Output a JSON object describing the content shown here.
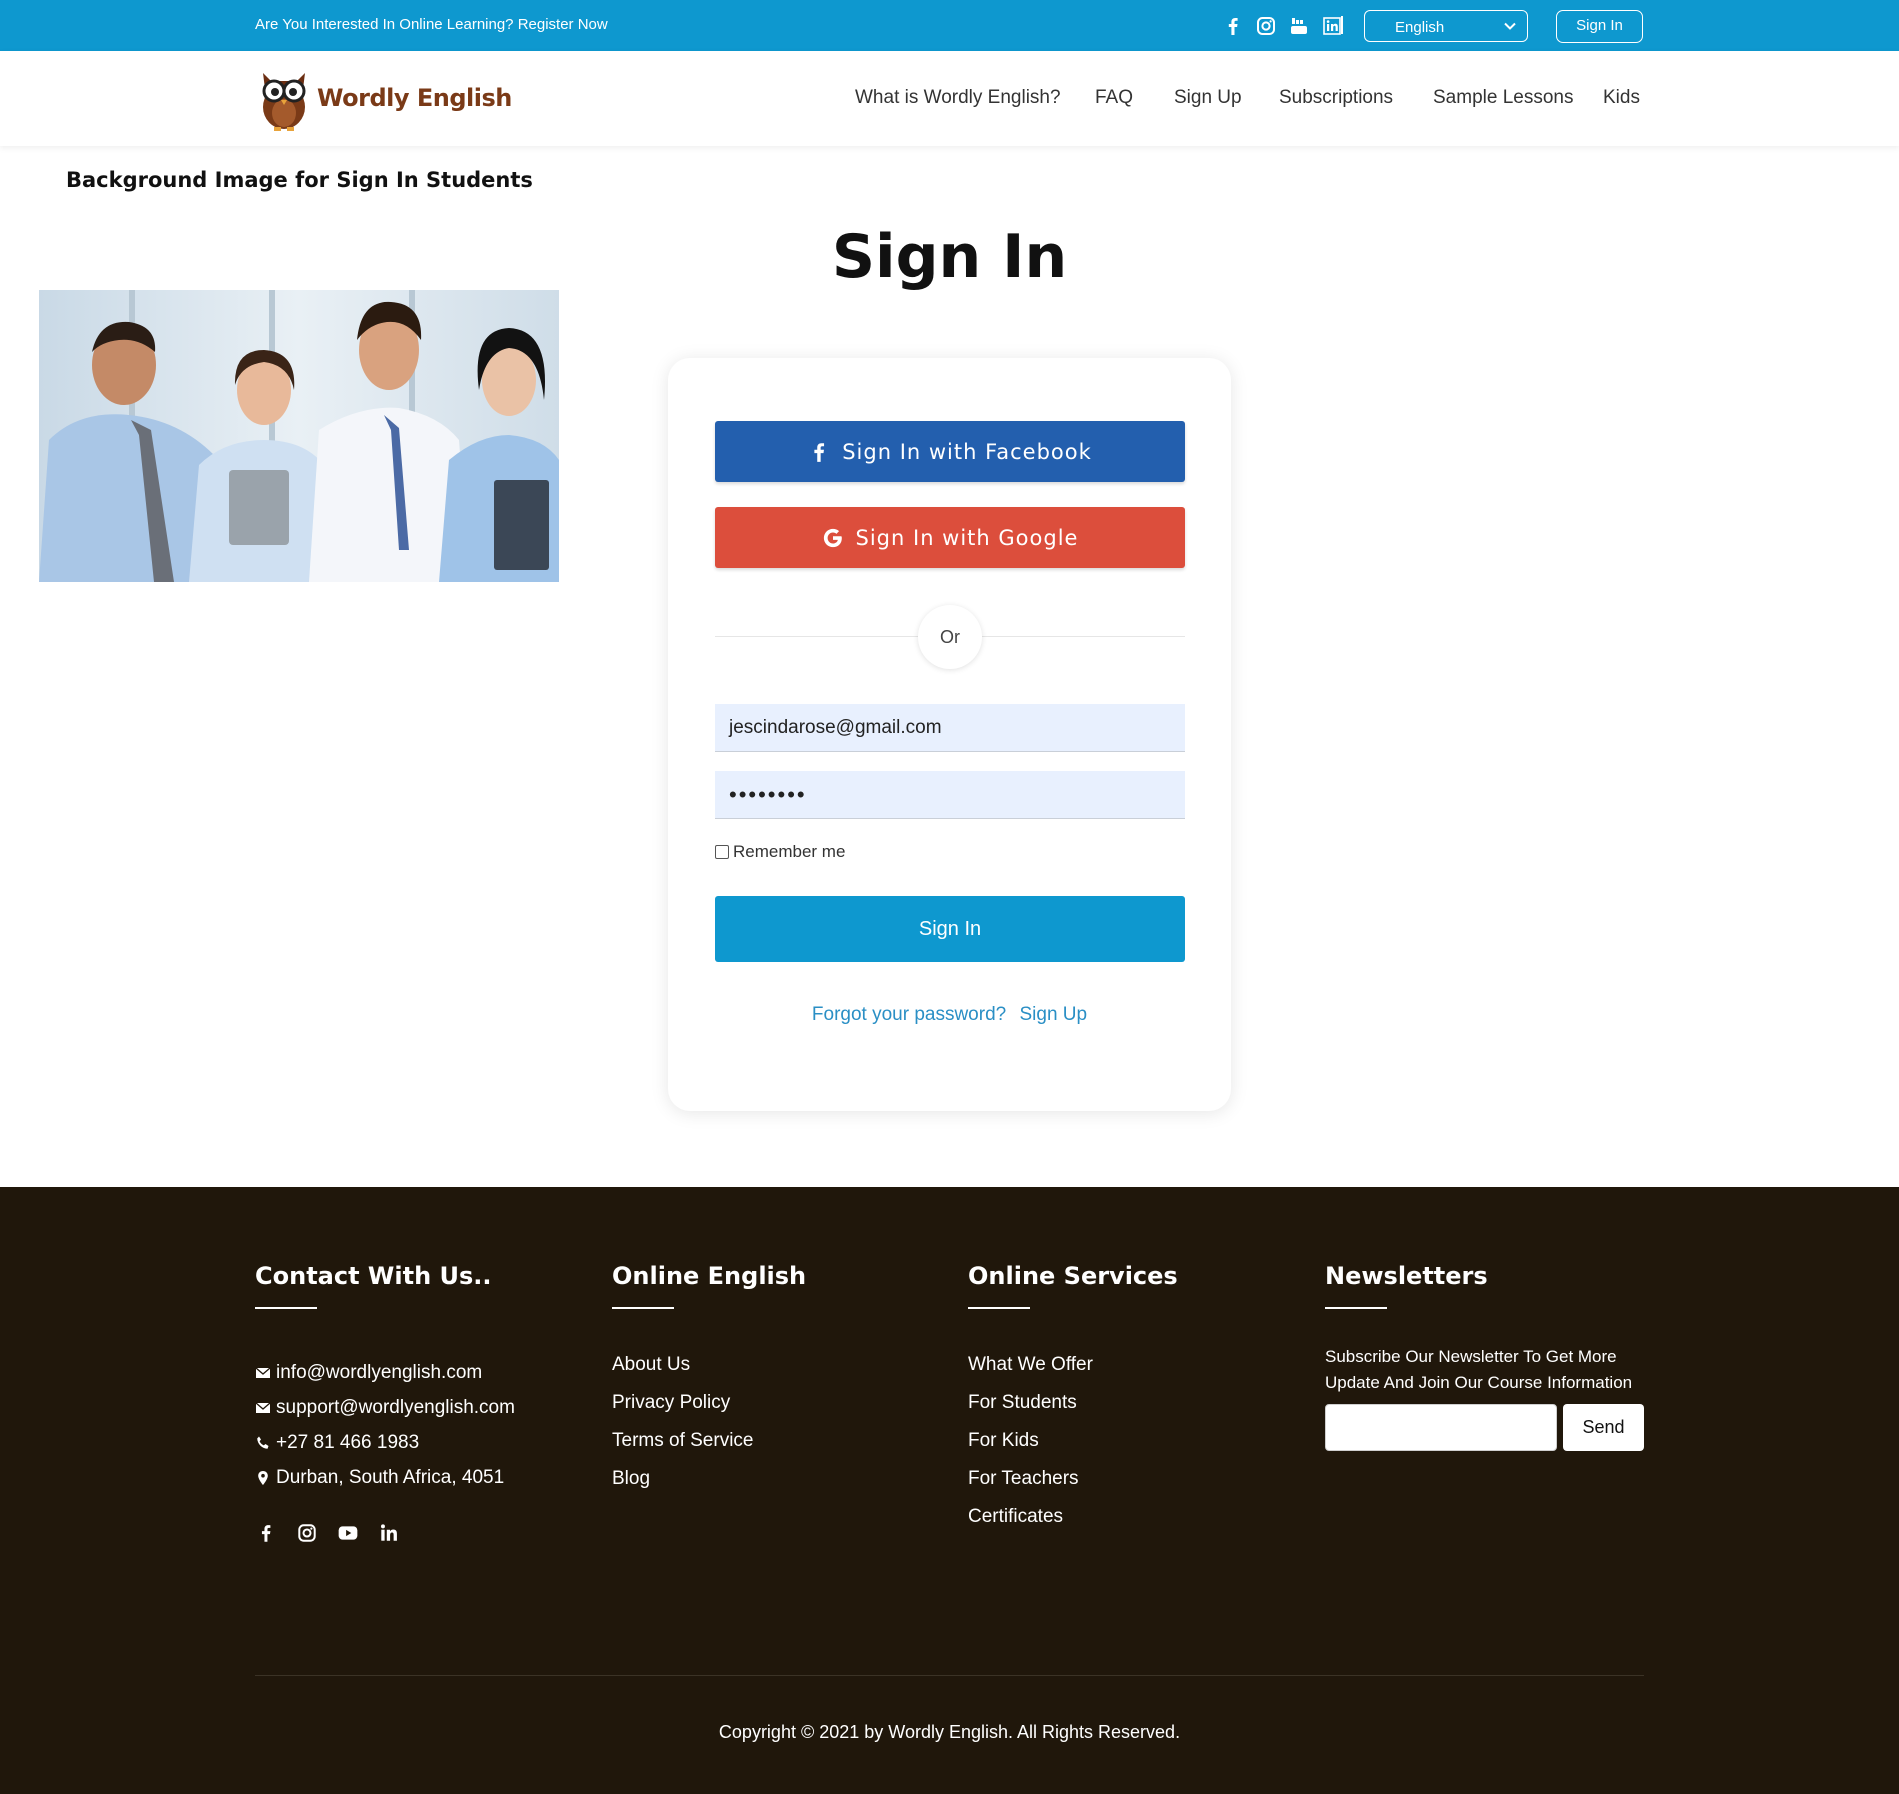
{
  "topbar": {
    "promo_text": "Are You Interested In Online Learning? Register Now",
    "social_icons": [
      "facebook-icon",
      "instagram-icon",
      "youtube-icon",
      "linkedin-icon"
    ],
    "language": "English",
    "signin_label": "Sign In",
    "bg_color": "#0e98cf"
  },
  "header": {
    "logo_text": "Wordly English",
    "nav": [
      "What is Wordly English?",
      "FAQ",
      "Sign Up",
      "Subscriptions",
      "Sample Lessons",
      "Kids"
    ]
  },
  "main": {
    "bg_caption": "Background Image for Sign In Students",
    "title": "Sign In",
    "card": {
      "facebook_label": "Sign In with Facebook",
      "google_label": "Sign In with Google",
      "or_label": "Or",
      "email_value": "jescindarose@gmail.com",
      "password_value": "••••••••",
      "remember_label": "Remember me",
      "remember_checked": false,
      "signin_label": "Sign In",
      "forgot_label": "Forgot your password?",
      "signup_label": "Sign Up"
    },
    "colors": {
      "facebook": "#235fae",
      "google": "#dc4e3c",
      "primary": "#0e98cf",
      "link": "#2a8fc5"
    }
  },
  "footer": {
    "contact": {
      "title": "Contact With Us..",
      "email1": "info@wordlyenglish.com",
      "email2": "support@wordlyenglish.com",
      "phone": "+27 81 466 1983",
      "address": "Durban, South Africa, 4051",
      "social_icons": [
        "facebook-icon",
        "instagram-icon",
        "youtube-icon",
        "linkedin-icon"
      ]
    },
    "online_english": {
      "title": "Online English",
      "links": [
        "About Us",
        "Privacy Policy",
        "Terms of Service",
        "Blog"
      ]
    },
    "online_services": {
      "title": "Online Services",
      "links": [
        "What We Offer",
        "For Students",
        "For Kids",
        "For Teachers",
        "Certificates"
      ]
    },
    "newsletters": {
      "title": "Newsletters",
      "text": "Subscribe Our Newsletter To Get More Update And Join Our Course Information",
      "send_label": "Send"
    },
    "copyright": "Copyright © 2021 by Wordly English. All Rights Reserved.",
    "bg_color": "#20170b"
  }
}
